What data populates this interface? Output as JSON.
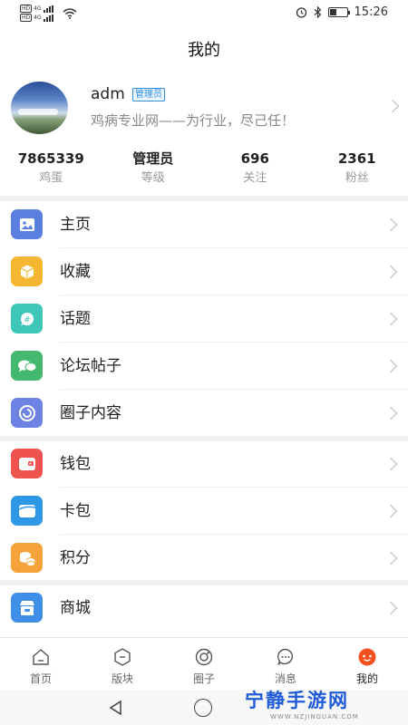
{
  "status_bar": {
    "hd_label": "HD",
    "net_label": "4G",
    "time": "15:26"
  },
  "header": {
    "title": "我的"
  },
  "profile": {
    "username": "adm",
    "role_badge": "管理员",
    "signature": "鸡病专业网——为行业，尽己任！"
  },
  "stats": [
    {
      "value": "7865339",
      "label": "鸡蛋"
    },
    {
      "value": "管理员",
      "label": "等级"
    },
    {
      "value": "696",
      "label": "关注"
    },
    {
      "value": "2361",
      "label": "粉丝"
    }
  ],
  "menu_group_1": [
    {
      "label": "主页",
      "icon": "image-icon",
      "color": "#5b7fe0"
    },
    {
      "label": "收藏",
      "icon": "box-icon",
      "color": "#f5b731"
    },
    {
      "label": "话题",
      "icon": "hashtag-chat-icon",
      "color": "#3ec7b8"
    },
    {
      "label": "论坛帖子",
      "icon": "chat-bubbles-icon",
      "color": "#43b86e"
    },
    {
      "label": "圈子内容",
      "icon": "swirl-circle-icon",
      "color": "#6c83e4"
    }
  ],
  "menu_group_2": [
    {
      "label": "钱包",
      "icon": "wallet-icon",
      "color": "#ef5350"
    },
    {
      "label": "卡包",
      "icon": "card-icon",
      "color": "#2e98e6"
    },
    {
      "label": "积分",
      "icon": "coins-icon",
      "color": "#f6a23a"
    }
  ],
  "menu_group_3": [
    {
      "label": "商城",
      "icon": "store-icon",
      "color": "#3f8fe8"
    }
  ],
  "tab_bar": [
    {
      "label": "首页",
      "icon": "home-icon"
    },
    {
      "label": "版块",
      "icon": "hexagon-icon"
    },
    {
      "label": "圈子",
      "icon": "circle-icon"
    },
    {
      "label": "消息",
      "icon": "message-icon"
    },
    {
      "label": "我的",
      "icon": "profile-icon"
    }
  ],
  "watermark": {
    "text": "宁静手游网",
    "sub": "WWW.NZJINGUAN.COM"
  },
  "colors": {
    "badge": "#2f8fe0",
    "active_tab": "#f4511e"
  }
}
